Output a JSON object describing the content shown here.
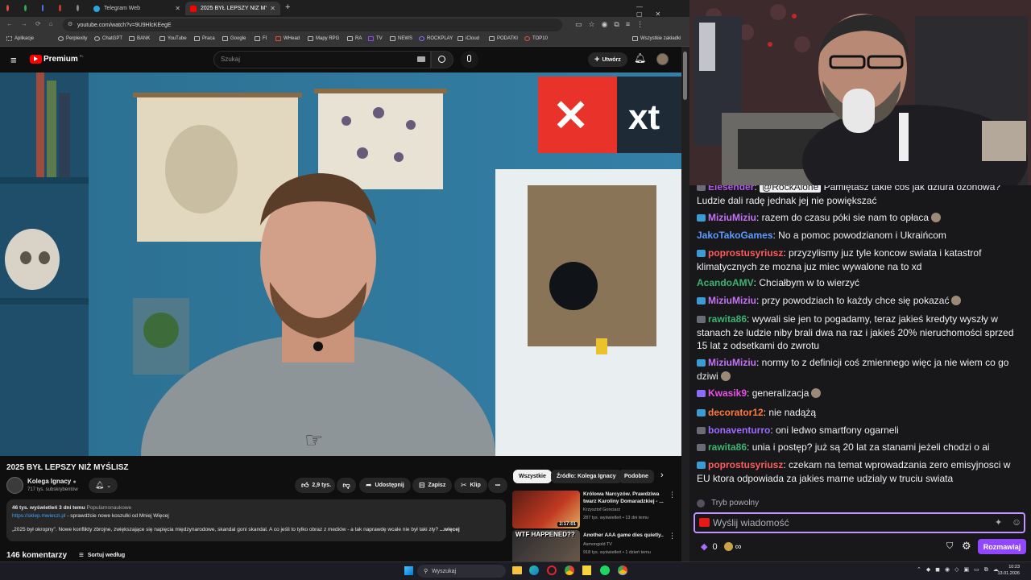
{
  "browser": {
    "tabs": [
      {
        "label": "Telegram Web"
      },
      {
        "label": "2025 BYŁ LEPSZY NIŻ MYŚLISZ"
      }
    ],
    "new_tab": "+",
    "url": "youtube.com/watch?v=9U9HlcKEegE",
    "bookmarks": [
      "Aplikacje",
      "Perplexity",
      "ChatGPT",
      "BANK",
      "YouTube",
      "Praca",
      "Google",
      "FI",
      "WHead",
      "Mapy RPG",
      "RA",
      "TV",
      "NEWS",
      "ROCKPLAY",
      "iCloud",
      "PODATKI",
      "TOP10"
    ],
    "all_bookmarks": "Wszystkie zakładki"
  },
  "youtube": {
    "logo_text": "Premium",
    "logo_sup": "PL",
    "search_placeholder": "Szukaj",
    "create_label": "Utwórz",
    "video_title": "2025 BYŁ LEPSZY NIŻ MYŚLISZ",
    "channel_name": "Kolega Ignacy",
    "subscribers": "717 tys. subskrybentów",
    "likes": "2,9 tys.",
    "share": "Udostępnij",
    "save": "Zapisz",
    "clip": "Klip",
    "more": "•••",
    "views_line": "46 tys. wyświetleń  3 dni temu",
    "category": "Popularnonaukowe",
    "desc_link": "https://sklep.mwieczi.pl",
    "desc_link_suffix": " - sprawdźcie nowe koszulki od Mniej Więcej",
    "desc_quote": "„2025 był okropny”. Nowe konflikty zbrojne, zwiększające się napięcia międzynarodowe, skandal goni skandal. A co jeśli to tylko obraz z mediów - a tak naprawdę wcale nie był taki zły?",
    "desc_more": "...więcej",
    "comments_count": "146 komentarzy",
    "sort_label": "Sortuj według",
    "video_overlay_text": "xt",
    "chips": [
      "Wszystkie",
      "Źródło: Kolega Ignacy",
      "Podobne"
    ],
    "recommendations": [
      {
        "title": "Królowa Narcyzów. Prawdziwa twarz Karoliny Domaradzkiej - ...",
        "channel": "Krzysztof Gonciarz",
        "meta": "287 tys. wyświetleń • 13 dni temu",
        "duration": "2:17:01",
        "thumb_text": ""
      },
      {
        "title": "Another AAA game dies quietly..",
        "channel": "Asmongold TV",
        "meta": "918 tys. wyświetleń • 1 dzień temu",
        "duration": "",
        "thumb_text": "WTF HAPPENED??"
      }
    ]
  },
  "chat": {
    "messages": [
      {
        "user": "Elesender",
        "color": "#b05ce8",
        "mention": "@RockAlone",
        "text": " Pamiętasz takie coś jak dziura ozonowa? Ludzie dali radę jednak jej nie powiększać"
      },
      {
        "user": "MiziuMiziu",
        "color": "#c472f5",
        "text": ": razem do czasu póki sie nam to opłaca"
      },
      {
        "user": "JakoTakoGames",
        "color": "#5c9cff",
        "text": ": No a pomoc powodzianom i Ukraińcom"
      },
      {
        "user": "poprostusyriusz",
        "color": "#ff5b5b",
        "text": ": przyzylismy juz tyle koncow swiata i katastrof klimatycznych ze mozna juz miec wywalone na to xd"
      },
      {
        "user": "AcandoAMV",
        "color": "#3cb371",
        "text": ": Chciałbym w to wierzyć"
      },
      {
        "user": "MiziuMiziu",
        "color": "#c472f5",
        "text": ": przy powodziach to każdy chce się pokazać"
      },
      {
        "user": "rawita86",
        "color": "#3cb371",
        "text": ": wywali sie jen to pogadamy, teraz jakieś kredyty wyszły w stanach że ludzie niby brali dwa na raz i jakieś 20% nieruchomości sprzed 15 lat z odsetkami do zwrotu"
      },
      {
        "user": "MiziuMiziu",
        "color": "#c472f5",
        "text": ": normy to z definicji coś zmiennego więc ja nie wiem co go dziwi"
      },
      {
        "user": "Kwasik9",
        "color": "#e84fe8",
        "text": ": generalizacja"
      },
      {
        "user": "decorator12",
        "color": "#ff7a3d",
        "text": ": nie nadążą"
      },
      {
        "user": "bonaventurro",
        "color": "#9b6cff",
        "text": ": oni ledwo smartfony ogarneli"
      },
      {
        "user": "rawita86",
        "color": "#3cb371",
        "text": ": unia i postęp? już są 20 lat za stanami jeżeli chodzi o ai"
      },
      {
        "user": "poprostusyriusz",
        "color": "#ff5b5b",
        "text": ": czekam na temat wprowadzania zero emisyjnosci w EU ktora odpowiada za jakies marne udzialy w truciu swiata"
      }
    ],
    "slow_mode": "Tryb powolny",
    "input_placeholder": "Wyślij wiadomość",
    "points": "0",
    "infinity": "∞",
    "send_button": "Rozmawiaj"
  },
  "taskbar": {
    "search_placeholder": "Wyszukaj",
    "time": "10:23",
    "date": "13.01.2026"
  },
  "colors": {
    "yt_red": "#ff0000",
    "twitch_purple": "#9147ff",
    "link_blue": "#3ea6ff"
  }
}
